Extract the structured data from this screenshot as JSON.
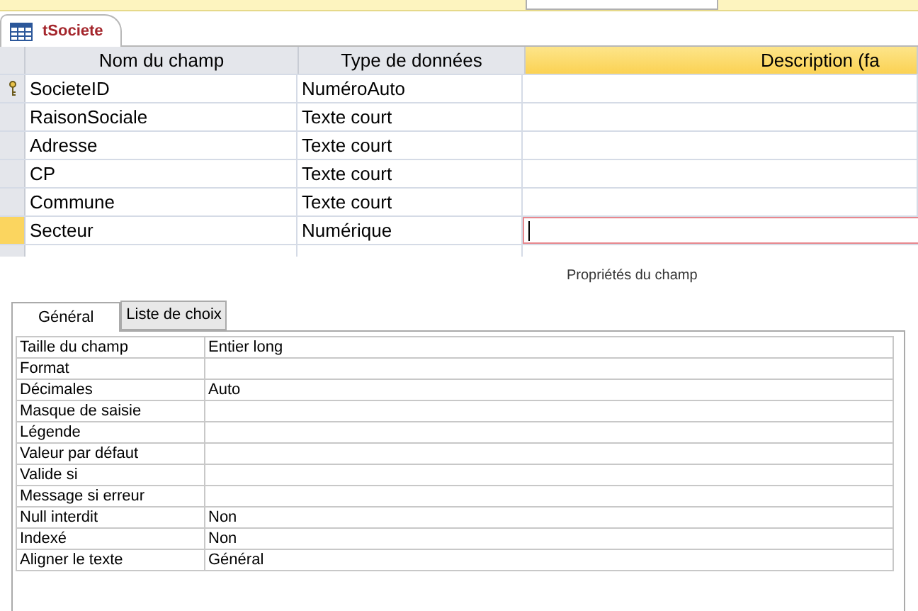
{
  "document_tab": {
    "title": "tSociete",
    "selected": true
  },
  "columns": [
    "Nom du champ",
    "Type de données",
    "Description (fa"
  ],
  "fields": [
    {
      "name": "SocieteID",
      "type": "NuméroAuto",
      "primary_key": true,
      "selected": false
    },
    {
      "name": "RaisonSociale",
      "type": "Texte court",
      "primary_key": false,
      "selected": false
    },
    {
      "name": "Adresse",
      "type": "Texte court",
      "primary_key": false,
      "selected": false
    },
    {
      "name": "CP",
      "type": "Texte court",
      "primary_key": false,
      "selected": false
    },
    {
      "name": "Commune",
      "type": "Texte court",
      "primary_key": false,
      "selected": false
    },
    {
      "name": "Secteur",
      "type": "Numérique",
      "primary_key": false,
      "selected": true
    }
  ],
  "properties_title": "Propriétés du champ",
  "property_tabs": [
    {
      "label": "Général",
      "selected": true
    },
    {
      "label": "Liste de choix",
      "selected": false
    }
  ],
  "properties": [
    {
      "name": "Taille du champ",
      "value": "Entier long"
    },
    {
      "name": "Format"
    },
    {
      "name": "Décimales",
      "value": "Auto"
    },
    {
      "name": "Masque de saisie"
    },
    {
      "name": "Légende"
    },
    {
      "name": "Valeur par défaut"
    },
    {
      "name": "Valide si"
    },
    {
      "name": "Message si erreur"
    },
    {
      "name": "Null interdit",
      "value": "Non"
    },
    {
      "name": "Indexé",
      "value": "Non"
    },
    {
      "name": "Aligner le texte",
      "value": "Général"
    }
  ]
}
